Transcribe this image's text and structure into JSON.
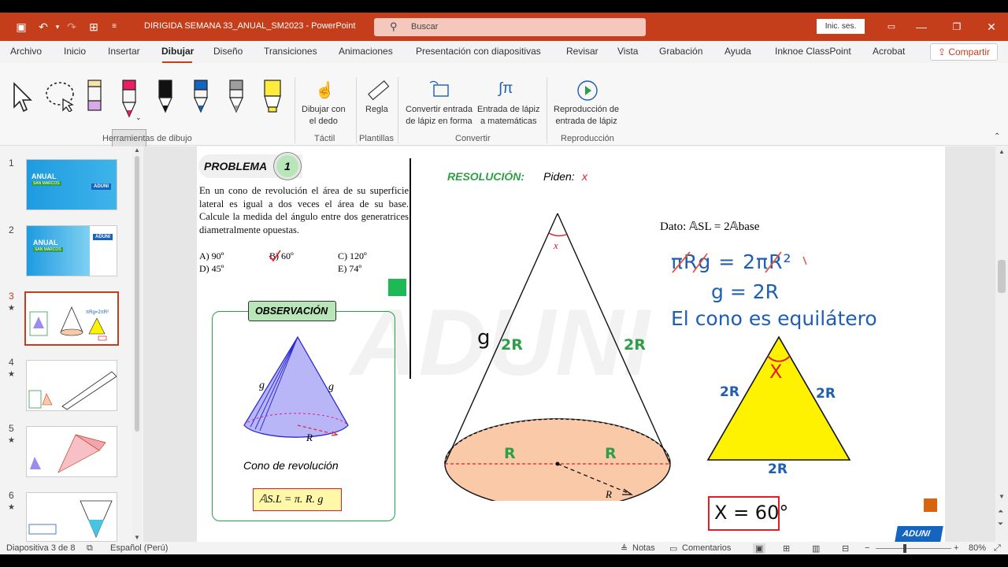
{
  "titlebar": {
    "doc_title": "DIRIGIDA SEMANA 33_ANUAL_SM2023  -  PowerPoint",
    "search_placeholder": "Buscar",
    "signin_label": "Inic. ses."
  },
  "menu": {
    "tabs": [
      "Archivo",
      "Inicio",
      "Insertar",
      "Dibujar",
      "Diseño",
      "Transiciones",
      "Animaciones",
      "Presentación con diapositivas",
      "Revisar",
      "Vista",
      "Grabación",
      "Ayuda",
      "Inknoe ClassPoint",
      "Acrobat"
    ],
    "active": "Dibujar",
    "share_label": "Compartir"
  },
  "ribbon": {
    "groups": {
      "drawing_tools": "Herramientas de dibujo",
      "touch": "Táctil",
      "stencils": "Plantillas",
      "convert": "Convertir",
      "replay": "Reproducción"
    },
    "buttons": {
      "draw_finger": "Dibujar con\nel dedo",
      "ruler": "Regla",
      "ink_to_shape": "Convertir entrada\nde lápiz en forma",
      "ink_to_math": "Entrada de lápiz\na matemáticas",
      "ink_replay": "Reproducción de\nentrada de lápiz"
    },
    "pen_colors": [
      "#f5e6a8",
      "#e91e63",
      "#111111",
      "#1565c0",
      "#9e9e9e",
      "#ffeb3b"
    ]
  },
  "thumbnails": {
    "numbers": [
      "1",
      "2",
      "3",
      "4",
      "5",
      "6"
    ],
    "selected": 3,
    "texts": {
      "t1_title": "ANUAL",
      "t1_sub": "SAN MARCOS",
      "t2_title": "ANUAL",
      "t2_sub": "SAN MARCOS",
      "brand": "ADUNI"
    }
  },
  "slide": {
    "problem_label": "PROBLEMA",
    "problem_number": "1",
    "problem_text": "En un cono de revolución el área de su superficie lateral es igual a dos veces el área de su base. Calcule la medida del ángulo entre dos generatrices diametralmente opuestas.",
    "options": {
      "a": "A) 90º",
      "b": "B) 60º",
      "c": "C) 120º",
      "d": "D) 45º",
      "e": "E) 74º"
    },
    "observation_label": "OBSERVACIÓN",
    "cone_caption": "Cono de revolución",
    "formula": "𝔸S.L = π. R. g",
    "obs_g_left": "g",
    "obs_g_right": "g",
    "obs_r": "R",
    "resolution_label": "RESOLUCIÓN:",
    "piden_label": "Piden:",
    "piden_var": "x",
    "cone_x": "x",
    "cone_g": "g",
    "cone_2r_left": "2R",
    "cone_2r_right": "2R",
    "cone_r_left": "R",
    "cone_r_right": "R",
    "cone_r_radius": "R",
    "dato": "Dato: 𝔸SL = 2𝔸base",
    "hand_line1": "πRg = 2πR²",
    "hand_line2": "g = 2R",
    "hand_line3": "El cono es equilátero",
    "tri_x": "X",
    "tri_left": "2R",
    "tri_right": "2R",
    "tri_bottom": "2R",
    "answer": "X = 60°",
    "brand": "ADUNI"
  },
  "statusbar": {
    "slide_info": "Diapositiva 3 de 8",
    "language": "Español (Perú)",
    "notes": "Notas",
    "comments": "Comentarios",
    "zoom": "80%"
  },
  "colors": {
    "accent": "#c43e1c",
    "title_green": "#2e9e48",
    "hand_blue": "#1e5fb4",
    "hand_green": "#2e9e48",
    "triangle_fill": "#fff200",
    "cone_base_fill": "#f9c9a8",
    "answer_border": "#e11d2a"
  }
}
